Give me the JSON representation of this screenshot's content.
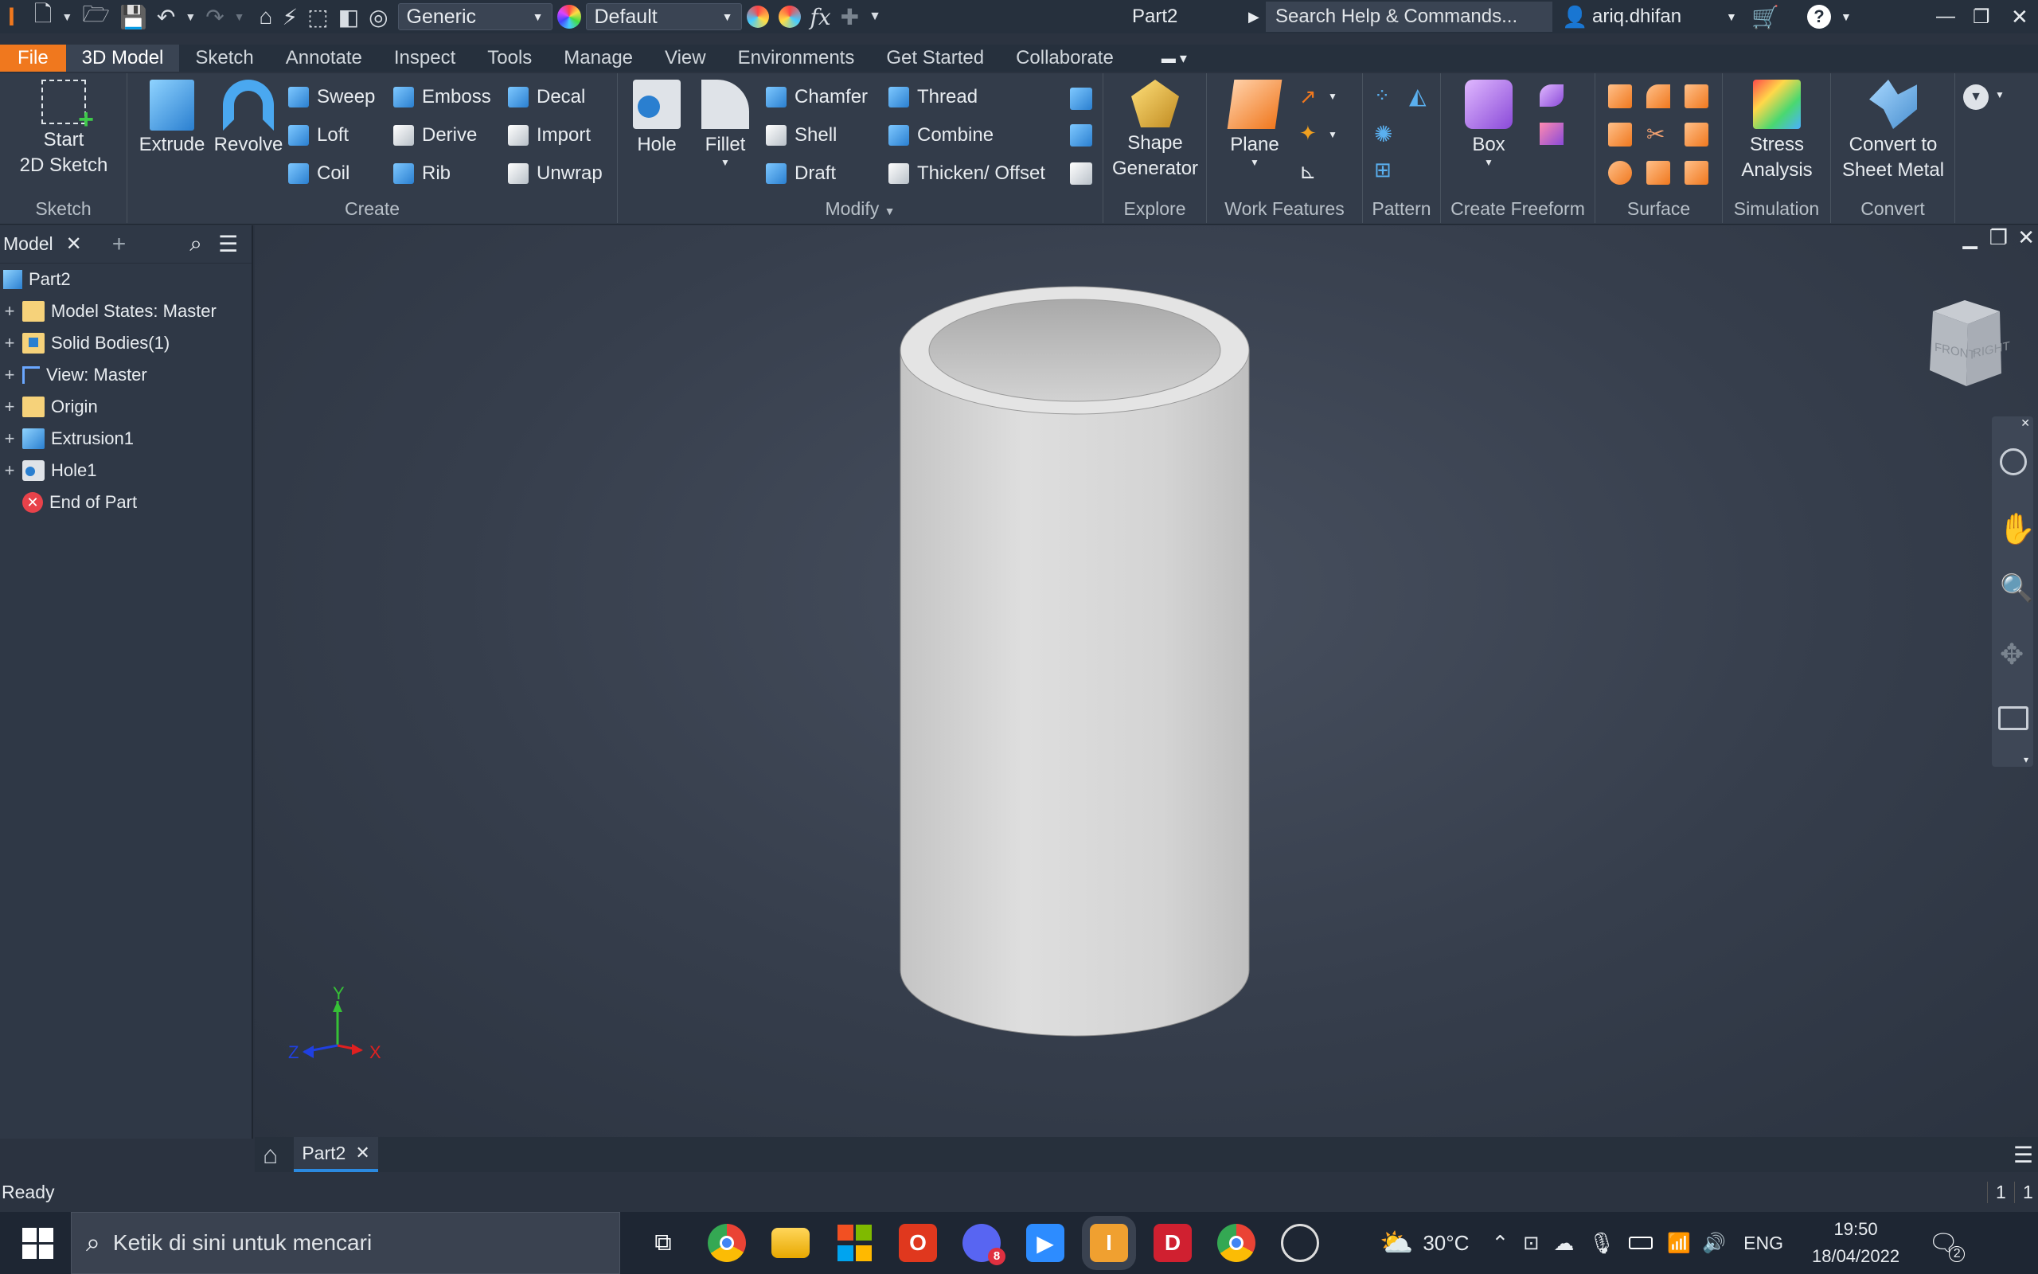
{
  "title_bar": {
    "appearance_combo": "Generic",
    "material_combo": "Default",
    "document_name": "Part2",
    "search_placeholder": "Search Help & Commands...",
    "user_name": "ariq.dhifan"
  },
  "tabs": [
    "File",
    "3D Model",
    "Sketch",
    "Annotate",
    "Inspect",
    "Tools",
    "Manage",
    "View",
    "Environments",
    "Get Started",
    "Collaborate"
  ],
  "ribbon": {
    "sketch": {
      "start_line1": "Start",
      "start_line2": "2D Sketch",
      "label": "Sketch"
    },
    "create": {
      "extrude": "Extrude",
      "revolve": "Revolve",
      "sweep": "Sweep",
      "loft": "Loft",
      "coil": "Coil",
      "emboss": "Emboss",
      "derive": "Derive",
      "rib": "Rib",
      "decal": "Decal",
      "import": "Import",
      "unwrap": "Unwrap",
      "label": "Create"
    },
    "modify": {
      "hole": "Hole",
      "fillet": "Fillet",
      "chamfer": "Chamfer",
      "shell": "Shell",
      "draft": "Draft",
      "thread": "Thread",
      "combine": "Combine",
      "thicken": "Thicken/ Offset",
      "label": "Modify"
    },
    "explore": {
      "line1": "Shape",
      "line2": "Generator",
      "label": "Explore"
    },
    "work_features": {
      "plane": "Plane",
      "label": "Work Features"
    },
    "pattern": {
      "label": "Pattern"
    },
    "freeform": {
      "box": "Box",
      "label": "Create Freeform"
    },
    "surface": {
      "label": "Surface"
    },
    "simulation": {
      "line1": "Stress",
      "line2": "Analysis",
      "label": "Simulation"
    },
    "convert": {
      "line1": "Convert to",
      "line2": "Sheet Metal",
      "label": "Convert"
    }
  },
  "browser": {
    "tab": "Model",
    "root": "Part2",
    "items": [
      {
        "label": "Model States: Master"
      },
      {
        "label": "Solid Bodies(1)"
      },
      {
        "label": "View: Master"
      },
      {
        "label": "Origin"
      },
      {
        "label": "Extrusion1"
      },
      {
        "label": "Hole1"
      },
      {
        "label": "End of Part"
      }
    ]
  },
  "viewcube": {
    "front": "FRONT",
    "right": "RIGHT"
  },
  "triad": {
    "x": "X",
    "y": "Y",
    "z": "Z"
  },
  "document_tab": "Part2",
  "status": {
    "text": "Ready",
    "count1": "1",
    "count2": "1"
  },
  "taskbar": {
    "search_placeholder": "Ketik di sini untuk mencari",
    "discord_badge": "8",
    "temperature": "30°C",
    "language": "ENG",
    "time": "19:50",
    "date": "18/04/2022",
    "notification_count": "2"
  },
  "colors": {
    "accent": "#f0781e",
    "ribbon_bg": "#333c4a",
    "viewport_bg": "#2b3340",
    "model": "#d9d9d9"
  }
}
